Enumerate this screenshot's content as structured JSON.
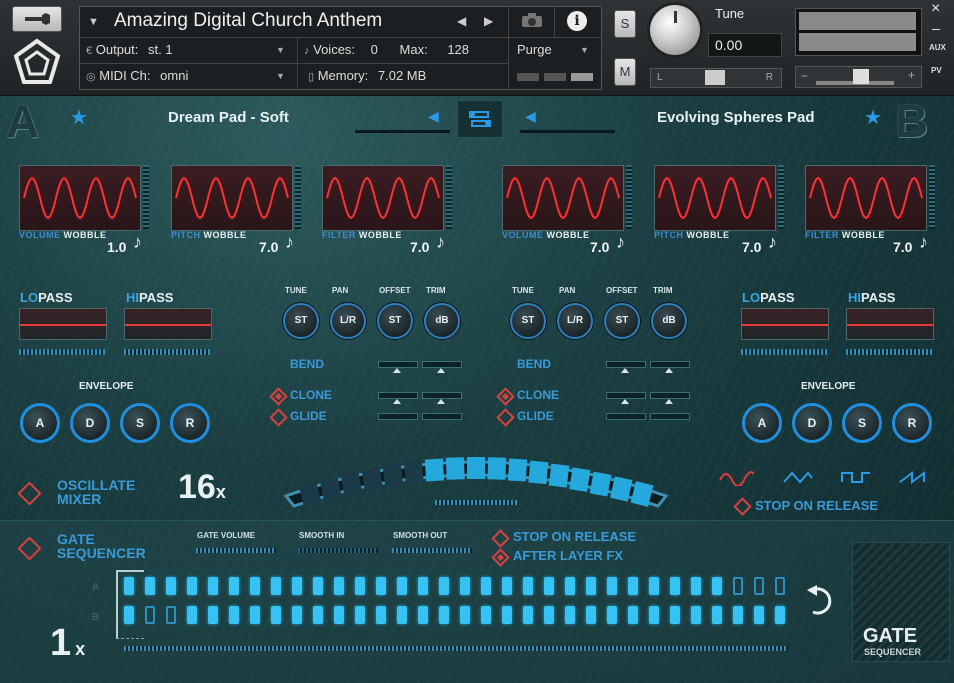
{
  "header": {
    "instrument_name": "Amazing Digital Church Anthem",
    "output_label": "Output:",
    "output_value": "st. 1",
    "voices_label": "Voices:",
    "voices_value": "0",
    "max_label": "Max:",
    "max_value": "128",
    "midi_label": "MIDI Ch:",
    "midi_value": "omni",
    "memory_label": "Memory:",
    "memory_value": "7.02 MB",
    "purge_label": "Purge",
    "solo_label": "S",
    "mute_label": "M",
    "tune_label": "Tune",
    "tune_value": "0.00",
    "pan_left": "L",
    "pan_right": "R",
    "aux_label": "AUX",
    "pv_label": "PV",
    "close_glyph": "×",
    "minimize_glyph": "–"
  },
  "layer_a": {
    "letter": "A",
    "name": "Dream Pad - Soft",
    "wobbles": [
      {
        "label_a": "VOLUME",
        "label_b": "WOBBLE",
        "value": "1.0"
      },
      {
        "label_a": "PITCH",
        "label_b": "WOBBLE",
        "value": "7.0"
      },
      {
        "label_a": "FILTER",
        "label_b": "WOBBLE",
        "value": "7.0"
      }
    ],
    "lopass_a": "LO",
    "lopass_b": "PASS",
    "hipass_a": "HI",
    "hipass_b": "PASS",
    "envelope_label": "ENVELOPE",
    "env_knobs": [
      "A",
      "D",
      "S",
      "R"
    ],
    "knob_titles": [
      "TUNE",
      "PAN",
      "OFFSET",
      "TRIM"
    ],
    "knob_labels": [
      "ST",
      "L/R",
      "ST",
      "dB"
    ],
    "bend_label": "BEND",
    "clone_label": "CLONE",
    "glide_label": "GLIDE"
  },
  "layer_b": {
    "letter": "B",
    "name": "Evolving Spheres Pad",
    "wobbles": [
      {
        "label_a": "VOLUME",
        "label_b": "WOBBLE",
        "value": "7.0"
      },
      {
        "label_a": "PITCH",
        "label_b": "WOBBLE",
        "value": "7.0"
      },
      {
        "label_a": "FILTER",
        "label_b": "WOBBLE",
        "value": "7.0"
      }
    ],
    "lopass_a": "LO",
    "lopass_b": "PASS",
    "hipass_a": "HI",
    "hipass_b": "PASS",
    "envelope_label": "ENVELOPE",
    "env_knobs": [
      "A",
      "D",
      "S",
      "R"
    ],
    "knob_titles": [
      "TUNE",
      "PAN",
      "OFFSET",
      "TRIM"
    ],
    "knob_labels": [
      "ST",
      "L/R",
      "ST",
      "dB"
    ],
    "bend_label": "BEND",
    "clone_label": "CLONE",
    "glide_label": "GLIDE"
  },
  "mixer": {
    "title_line1": "OSCILLATE",
    "title_line2": "MIXER",
    "rate_value": "16",
    "rate_suffix": "x",
    "stop_on_release": "STOP ON RELEASE",
    "arc_segments_active": 10,
    "arc_segments_total": 17
  },
  "gate": {
    "title_line1": "GATE",
    "title_line2": "SEQUENCER",
    "gate_volume": "GATE VOLUME",
    "smooth_in": "SMOOTH IN",
    "smooth_out": "SMOOTH OUT",
    "stop_on_release": "STOP ON RELEASE",
    "after_layer_fx": "AFTER LAYER FX",
    "row_a_label": "A",
    "row_b_label": "B",
    "rate_value": "1",
    "rate_suffix": "x",
    "logo_line1": "GATE",
    "logo_line2": "SEQUENCER",
    "row_a_steps": [
      1,
      1,
      1,
      1,
      1,
      1,
      1,
      1,
      1,
      1,
      1,
      1,
      1,
      1,
      1,
      1,
      1,
      1,
      1,
      1,
      1,
      1,
      1,
      1,
      1,
      1,
      1,
      1,
      1,
      0,
      0,
      0
    ],
    "row_b_steps": [
      1,
      0,
      0,
      1,
      1,
      1,
      1,
      1,
      1,
      1,
      1,
      1,
      1,
      1,
      1,
      1,
      1,
      1,
      1,
      1,
      1,
      1,
      1,
      1,
      1,
      1,
      1,
      1,
      1,
      1,
      1,
      1
    ]
  }
}
